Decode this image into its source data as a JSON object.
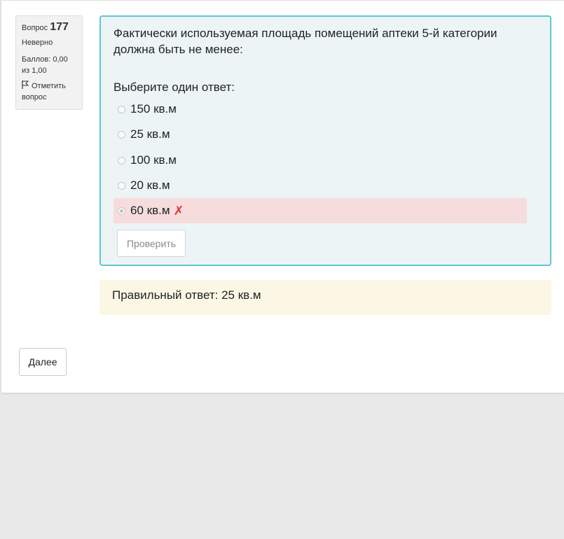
{
  "question_info": {
    "number_prefix": "Вопрос",
    "number": "177",
    "state": "Неверно",
    "grade": "Баллов: 0,00 из 1,00",
    "flag_label": "Отметить вопрос"
  },
  "question": {
    "text": "Фактически используемая площадь помещений аптеки 5-й категории должна быть не менее:",
    "prompt": "Выберите один ответ:",
    "answers": [
      {
        "label": "150 кв.м",
        "selected": false,
        "incorrect": false
      },
      {
        "label": "25 кв.м",
        "selected": false,
        "incorrect": false
      },
      {
        "label": "100 кв.м",
        "selected": false,
        "incorrect": false
      },
      {
        "label": "20 кв.м",
        "selected": false,
        "incorrect": false
      },
      {
        "label": "60 кв.м",
        "selected": true,
        "incorrect": true
      }
    ],
    "incorrect_icon": "cross-icon",
    "check_label": "Проверить"
  },
  "feedback": {
    "right_answer": "Правильный ответ: 25 кв.м"
  },
  "navigation": {
    "next_label": "Далее"
  },
  "colors": {
    "formulation_bg": "#edf4f6",
    "formulation_border": "#5ec7d1",
    "incorrect_bg": "#f6dcdc",
    "incorrect_mark": "#e03535",
    "feedback_bg": "#fcf7e4"
  }
}
